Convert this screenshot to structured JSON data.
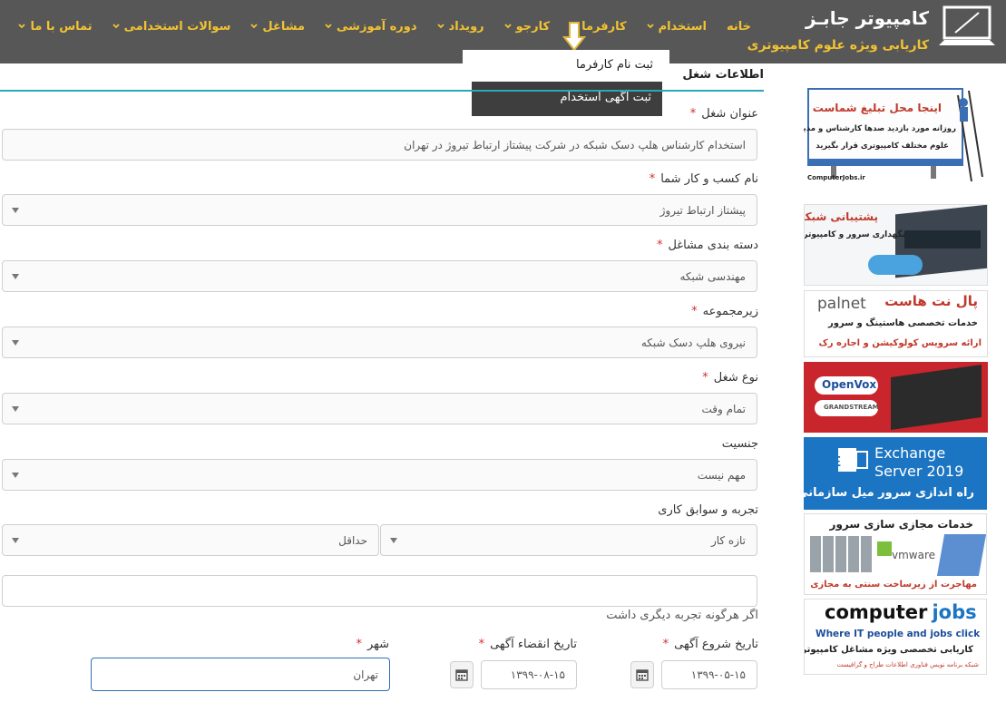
{
  "site": {
    "title": "کامپیوتر جابـز",
    "subtitle": "کاریابی ویژه علوم کامپیوتری"
  },
  "nav": [
    {
      "label": "خانه",
      "has_menu": false
    },
    {
      "label": "استخدام",
      "has_menu": true
    },
    {
      "label": "کارفرما",
      "has_menu": true
    },
    {
      "label": "کارجو",
      "has_menu": true
    },
    {
      "label": "رویداد",
      "has_menu": true
    },
    {
      "label": "دوره آموزشی",
      "has_menu": true
    },
    {
      "label": "مشاغل",
      "has_menu": true
    },
    {
      "label": "سوالات استخدامی",
      "has_menu": true
    },
    {
      "label": "تماس با ما",
      "has_menu": true
    }
  ],
  "dropdown": {
    "items": [
      "ثبت نام کارفرما",
      "ثبت آگهی استخدام"
    ]
  },
  "form": {
    "section_title": "اطلاعات شغل",
    "job_title": {
      "label": "عنوان شغل",
      "value": "استخدام کارشناس هلپ دسک شبکه در شرکت پیشتاز ارتباط تیروژ در تهران"
    },
    "business_name": {
      "label": "نام کسب و کار شما",
      "value": "پیشتاز ارتباط تیروژ"
    },
    "category": {
      "label": "دسته بندی مشاغل",
      "value": "مهندسی شبکه"
    },
    "subcategory": {
      "label": "زیرمجموعه",
      "value": "نیروی هلپ دسک شبکه"
    },
    "job_type": {
      "label": "نوع شغل",
      "value": "تمام وقت"
    },
    "gender": {
      "label": "جنسیت",
      "value": "مهم نیست"
    },
    "experience": {
      "label": "تجربه و سوابق کاری",
      "value_right": "تازه کار",
      "value_left": "حداقل",
      "hint": "اگر هرگونه تجربه دیگری داشت",
      "other_value": ""
    },
    "start_date": {
      "label": "تاریخ شروع آگهی",
      "value": "۱۳۹۹-۰۵-۱۵"
    },
    "end_date": {
      "label": "تاریخ انقضاء آگهی",
      "value": "۱۳۹۹-۰۸-۱۵"
    },
    "city": {
      "label": "شهر",
      "value": "تهران"
    }
  },
  "ads": {
    "billboard": {
      "line1": "اینجا محل تبلیغ شماست",
      "line2": "روزانه مورد بازدید صدها کارشناس و مدیر",
      "line3": "علوم مختلف کامپیوتری قرار بگیرید",
      "footer": "ComputerJobs.ir"
    },
    "network": {
      "line1": "پشتیبانی شبکه",
      "line2": "نگهداری سرور و کامپیوتر"
    },
    "palnet": {
      "brand": "palnet",
      "line1": "پال نت هاست",
      "line2": "خدمات تخصصی هاستینگ و سرور",
      "line3": "ارائه سرویس کولوکیشن و اجاره رک"
    },
    "openvox": {
      "brand1": "OpenVox",
      "brand2": "GRANDSTREAM"
    },
    "exchange": {
      "line1": "Exchange",
      "line2": "Server 2019",
      "line3": "راه اندازی سرور میل سازمانی"
    },
    "vmware": {
      "line1": "خدمات مجازی سازی سرور",
      "brand": "vmware",
      "line2": "مهاجرت از زیرساخت سنتی به مجازی"
    },
    "cjobs": {
      "line1": "computer",
      "line1b": "jobs",
      "line2": "Where IT people and jobs click",
      "line3": "کاریابی تخصصی ویژه مشاغل کامپیوتری",
      "line4": "شبکه  برنامه نویس  فناوری اطلاعات  طراح و گرافیست"
    }
  },
  "colors": {
    "header_bg": "#575757",
    "nav_text": "#f1c232",
    "accent_line": "#26a9b8",
    "required": "#d32f2f"
  }
}
